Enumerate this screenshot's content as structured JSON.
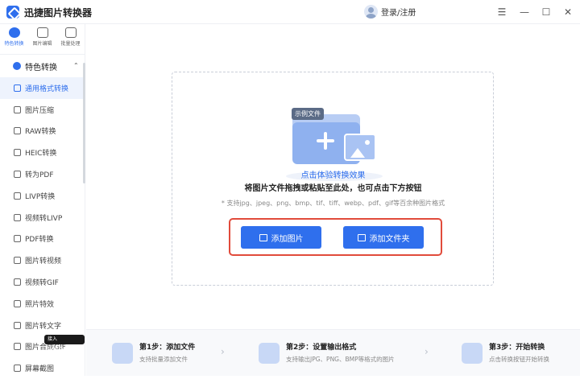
{
  "app": {
    "title": "迅捷图片转换器",
    "login": "登录/注册",
    "accent": "#2f6fed"
  },
  "window_controls": {
    "menu": "☰",
    "minimize": "—",
    "maximize": "☐",
    "close": "✕"
  },
  "top_tabs": [
    {
      "label": "特色转换",
      "icon": "feature-convert-icon",
      "active": true
    },
    {
      "label": "图片编辑",
      "icon": "image-edit-icon",
      "active": false
    },
    {
      "label": "批量处理",
      "icon": "batch-process-icon",
      "active": false
    }
  ],
  "sidebar": {
    "section_label": "特色转换",
    "items": [
      {
        "label": "通用格式转换",
        "active": true
      },
      {
        "label": "图片压缩"
      },
      {
        "label": "RAW转换"
      },
      {
        "label": "HEIC转换"
      },
      {
        "label": "转为PDF"
      },
      {
        "label": "LIVP转换"
      },
      {
        "label": "视频转LIVP"
      },
      {
        "label": "PDF转换"
      },
      {
        "label": "图片转视频"
      },
      {
        "label": "视频转GIF"
      },
      {
        "label": "照片特效"
      },
      {
        "label": "图片转文字"
      },
      {
        "label": "图片合成GIF"
      },
      {
        "label": "屏幕截图"
      }
    ],
    "badge": "接入 DeepSeek V3"
  },
  "dropzone": {
    "sample_tag": "示例文件",
    "demo_link": "点击体验转换效果",
    "hint": "将图片文件拖拽或粘贴至此处，也可点击下方按钮",
    "formats": "* 支持jpg、jpeg、png、bmp、tif、tiff、webp、pdf、gif等百余种图片格式",
    "add_image": "添加图片",
    "add_folder": "添加文件夹"
  },
  "steps": [
    {
      "title": "第1步：添加文件",
      "desc": "支持批量添加文件"
    },
    {
      "title": "第2步：设置输出格式",
      "desc": "支持输出JPG、PNG、BMP等格式的图片"
    },
    {
      "title": "第3步：开始转换",
      "desc": "点击转换按钮开始转换"
    }
  ]
}
